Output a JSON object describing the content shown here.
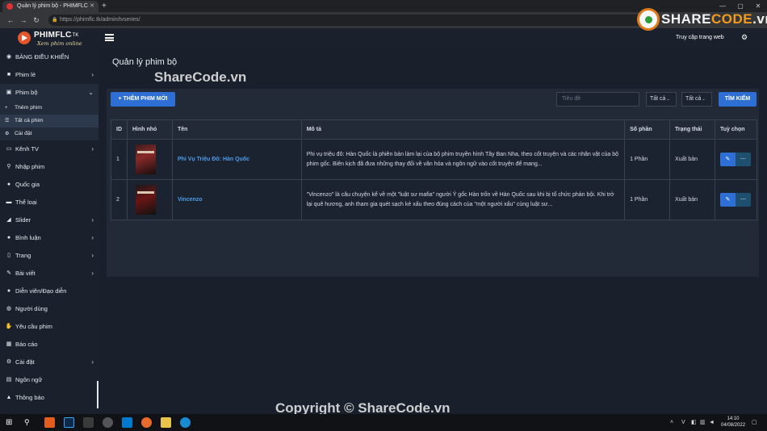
{
  "browser": {
    "tab_title": "Quản lý phim bộ - PHIMFLC",
    "url": "https://phimflc.tk/admin/tvseries/"
  },
  "header": {
    "logo_title": "PHIMFLC",
    "logo_tk": ".TK",
    "logo_subtitle": "Xem phim online",
    "visit_link": "Truy cập trang web"
  },
  "sidebar": {
    "items": [
      {
        "label": "BẢNG ĐIỀU KHIỂN",
        "icon": "dashboard-icon"
      },
      {
        "label": "Phim lẻ",
        "icon": "video-icon"
      },
      {
        "label": "Phim bộ",
        "icon": "film-icon"
      },
      {
        "label": "Kênh TV",
        "icon": "tv-icon"
      },
      {
        "label": "Nhập phim",
        "icon": "search-icon"
      },
      {
        "label": "Quốc gia",
        "icon": "globe-icon"
      },
      {
        "label": "Thể loại",
        "icon": "folder-icon"
      },
      {
        "label": "Slider",
        "icon": "slider-icon"
      },
      {
        "label": "Bình luận",
        "icon": "comment-icon"
      },
      {
        "label": "Trang",
        "icon": "pages-icon"
      },
      {
        "label": "Bài viết",
        "icon": "edit-icon"
      },
      {
        "label": "Diễn viên/Đạo diễn",
        "icon": "users-icon"
      },
      {
        "label": "Người dùng",
        "icon": "user-icon"
      },
      {
        "label": "Yêu cầu phim",
        "icon": "request-icon"
      },
      {
        "label": "Báo cáo",
        "icon": "report-icon"
      },
      {
        "label": "Cài đặt",
        "icon": "gears-icon"
      },
      {
        "label": "Ngôn ngữ",
        "icon": "language-icon"
      },
      {
        "label": "Thông báo",
        "icon": "bell-icon"
      }
    ],
    "sub_items": [
      {
        "label": "Thêm phim"
      },
      {
        "label": "Tất cả phim"
      },
      {
        "label": "Cài đặt"
      }
    ]
  },
  "main": {
    "page_title": "Quản lý phim bộ",
    "add_button": "+ THÊM PHIM MỚI",
    "search_placeholder": "Tiêu đề",
    "filter1": "Tất cả",
    "filter2": "Tất cả",
    "search_button": "TÌM KIẾM",
    "table": {
      "headers": [
        "ID",
        "Hình nhỏ",
        "Tên",
        "Mô tả",
        "Số phần",
        "Trạng thái",
        "Tuỳ chọn"
      ],
      "rows": [
        {
          "id": "1",
          "name": "Phi Vụ Triệu Đô: Hàn Quốc",
          "description": "Phi vụ triệu đô: Hàn Quốc là phiên bản làm lại của bộ phim truyền hình Tây Ban Nha, theo cốt truyện và các nhân vật của bộ phim gốc. Biên kịch đã đưa những thay đổi về văn hóa và ngôn ngữ vào cốt truyện để mang...",
          "seasons": "1 Phần",
          "status": "Xuất bản"
        },
        {
          "id": "2",
          "name": "Vincenzo",
          "description": "\"Vincenzo\" là câu chuyện kể về một \"luật sư mafia\" người Ý gốc Hàn trốn về Hàn Quốc sau khi bị tổ chức phản bội. Khi trở lại quê hương, anh tham gia quét sạch kẻ xấu theo đúng cách của \"một người xấu\" cùng luật sư...",
          "seasons": "1 Phần",
          "status": "Xuất bản"
        }
      ]
    }
  },
  "watermarks": {
    "top": "ShareCode.vn",
    "bottom": "Copyright © ShareCode.vn",
    "logo_share": "SHARE",
    "logo_code": "CODE",
    "logo_vn": ".vn"
  },
  "taskbar": {
    "time": "14:10",
    "date": "04/08/2022",
    "lang": "V"
  },
  "colors": {
    "accent": "#2e6fd6",
    "link": "#4e9be8",
    "sidebar_bg": "#1a202c",
    "content_bg": "#19202b"
  }
}
